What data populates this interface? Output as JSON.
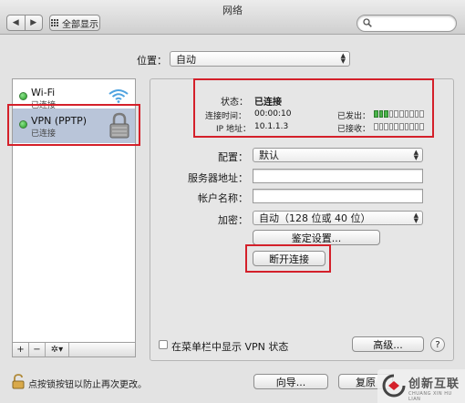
{
  "window": {
    "title": "网络"
  },
  "toolbar": {
    "back": "◀",
    "forward": "▶",
    "show_all": "全部显示"
  },
  "location": {
    "label": "位置：",
    "value": "自动"
  },
  "sidebar": {
    "services": [
      {
        "name": "Wi-Fi",
        "status": "已连接",
        "icon": "wifi-icon"
      },
      {
        "name": "VPN (PPTP)",
        "status": "已连接",
        "icon": "lock-icon"
      }
    ],
    "add": "+",
    "remove": "−",
    "action": "✲▾"
  },
  "status": {
    "label": "状态：",
    "value": "已连接",
    "connect_time_label": "连接时间：",
    "connect_time": "00:00:10",
    "ip_label": "IP 地址：",
    "ip": "10.1.1.3",
    "sent_label": "已发出：",
    "received_label": "已接收：",
    "sent_level": 0.3,
    "received_level": 0.0
  },
  "form": {
    "config_label": "配置：",
    "config_value": "默认",
    "server_label": "服务器地址：",
    "server_value": "",
    "account_label": "帐户名称：",
    "account_value": "",
    "encryption_label": "加密：",
    "encryption_value": "自动（128 位或 40 位）",
    "auth_button": "鉴定设置...",
    "disconnect_button": "断开连接"
  },
  "footer": {
    "menubar_checkbox_label": "在菜单栏中显示 VPN 状态",
    "advanced_button": "高级...",
    "help_button": "?",
    "lock_text": "点按锁按钮以防止再次更改。",
    "assist_button": "向导...",
    "revert_button": "复原"
  },
  "watermark": {
    "text": "创新互联",
    "sub": "CHUANG XIN HU LIAN"
  },
  "colors": {
    "highlight": "#d4202a",
    "selection": "#b9c5d9",
    "status_green": "#4ab44a"
  }
}
